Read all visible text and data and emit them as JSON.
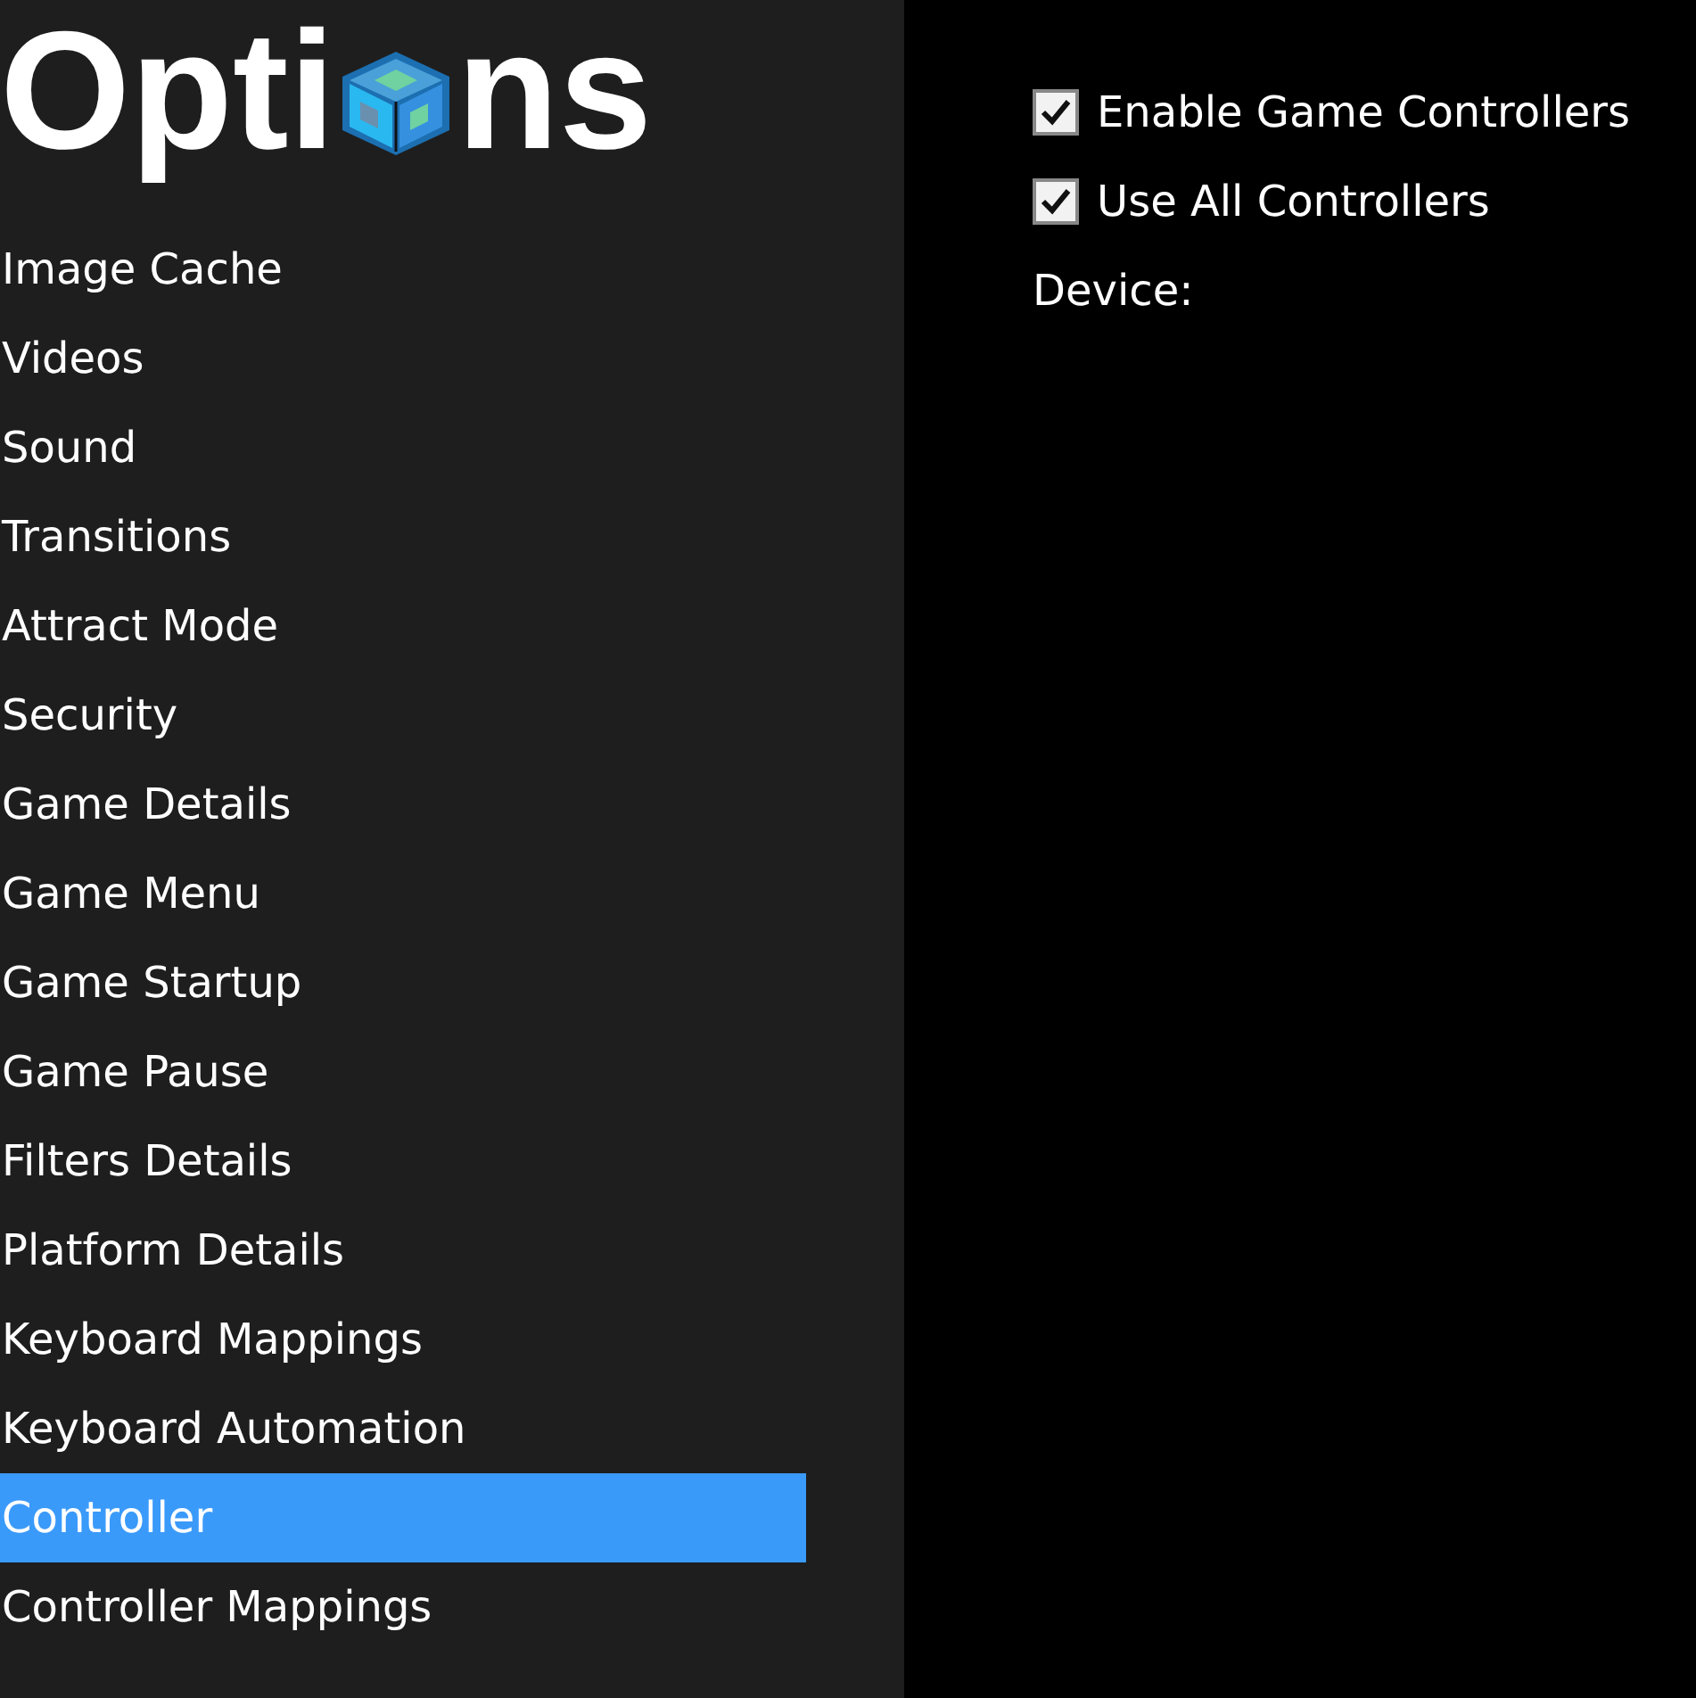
{
  "title": {
    "before": "Opti",
    "after": "ns"
  },
  "sidebar": {
    "items": [
      {
        "label": "Image Cache",
        "selected": false
      },
      {
        "label": "Videos",
        "selected": false
      },
      {
        "label": "Sound",
        "selected": false
      },
      {
        "label": "Transitions",
        "selected": false
      },
      {
        "label": "Attract Mode",
        "selected": false
      },
      {
        "label": "Security",
        "selected": false
      },
      {
        "label": "Game Details",
        "selected": false
      },
      {
        "label": "Game Menu",
        "selected": false
      },
      {
        "label": "Game Startup",
        "selected": false
      },
      {
        "label": "Game Pause",
        "selected": false
      },
      {
        "label": "Filters Details",
        "selected": false
      },
      {
        "label": "Platform Details",
        "selected": false
      },
      {
        "label": "Keyboard Mappings",
        "selected": false
      },
      {
        "label": "Keyboard Automation",
        "selected": false
      },
      {
        "label": "Controller",
        "selected": true
      },
      {
        "label": "Controller Mappings",
        "selected": false
      }
    ]
  },
  "settings": [
    {
      "kind": "checkbox",
      "label": "Enable Game Controllers",
      "checked": true
    },
    {
      "kind": "checkbox",
      "label": "Use All Controllers",
      "checked": true
    },
    {
      "kind": "label",
      "label": "Device:"
    }
  ]
}
